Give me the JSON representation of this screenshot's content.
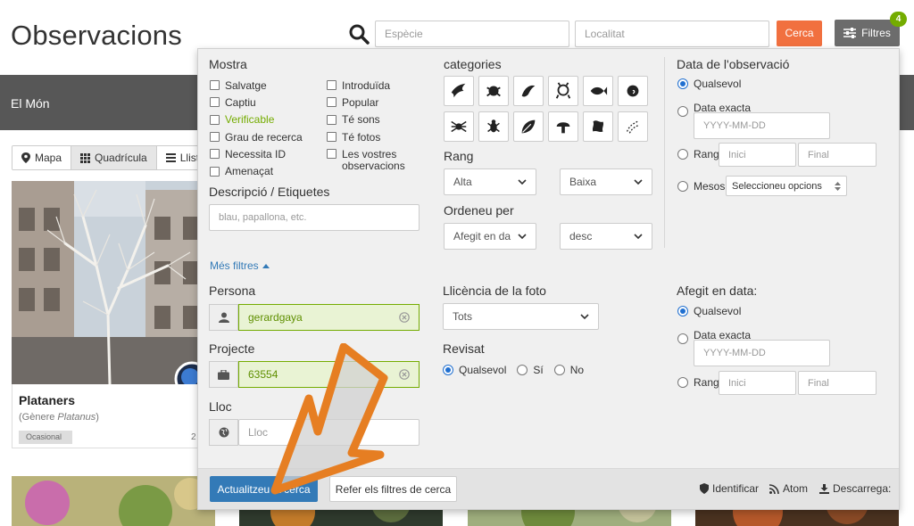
{
  "header": {
    "title": "Observacions",
    "species_placeholder": "Espècie",
    "location_placeholder": "Localitat",
    "search_label": "Cerca",
    "filters_label": "Filtres",
    "filters_count": "4"
  },
  "band": {
    "place": "El Món"
  },
  "view_tabs": [
    "Mapa",
    "Quadrícula",
    "Llista"
  ],
  "card": {
    "title": "Plataners",
    "subtitle_prefix": "(Gènere ",
    "subtitle_genus": "Platanus",
    "subtitle_suffix": ")",
    "tag": "Ocasional",
    "date": "2"
  },
  "filters": {
    "show_title": "Mostra",
    "show_left": [
      {
        "label": "Salvatge",
        "green": false
      },
      {
        "label": "Captiu",
        "green": false
      },
      {
        "label": "Verificable",
        "green": true
      },
      {
        "label": "Grau de recerca",
        "green": false
      },
      {
        "label": "Necessita ID",
        "green": false
      },
      {
        "label": "Amenaçat",
        "green": false
      }
    ],
    "show_right": [
      "Introduïda",
      "Popular",
      "Té sons",
      "Té fotos",
      "Les vostres"
    ],
    "show_right_cont": "observacions",
    "desc_title": "Descripció / Etiquetes",
    "desc_placeholder": "blau, papallona, etc.",
    "categories_title": "categories",
    "category_icons": [
      "bird-icon",
      "amphibian-icon",
      "reptile-icon",
      "mammal-icon",
      "fish-icon",
      "mollusk-icon",
      "arachnid-icon",
      "insect-icon",
      "plant-icon",
      "fungi-icon",
      "protozoa-icon",
      "unknown-icon"
    ],
    "rank_title": "Rang",
    "rank_high": "Alta",
    "rank_low": "Baixa",
    "order_title": "Ordeneu per",
    "order_by": "Afegit en da",
    "order_dir": "desc",
    "date_title": "Data de l'observació",
    "date_any": "Qualsevol",
    "date_exact": "Data exacta",
    "date_placeholder": "YYYY-MM-DD",
    "date_range": "Rang",
    "range_start": "Inici",
    "range_end": "Final",
    "months": "Mesos",
    "months_select": "Seleccioneu opcions",
    "more_filters": "Més filtres",
    "person_title": "Persona",
    "person_value": "gerardgaya",
    "project_title": "Projecte",
    "project_value": "63554",
    "place_title": "Lloc",
    "place_placeholder": "Lloc",
    "license_title": "Llicència de la foto",
    "license_value": "Tots",
    "reviewed_title": "Revisat",
    "reviewed_any": "Qualsevol",
    "reviewed_yes": "Sí",
    "reviewed_no": "No",
    "added_title": "Afegit en data:",
    "added_any": "Qualsevol",
    "added_exact": "Data exacta",
    "added_placeholder": "YYYY-MM-DD",
    "added_range": "Rang",
    "added_start": "Inici",
    "added_end": "Final"
  },
  "footer": {
    "update": "Actualitzeu la cerca",
    "reset": "Refer els filtres de cerca",
    "identify": "Identificar",
    "atom": "Atom",
    "download": "Descarrega:"
  },
  "colors": {
    "accent_orange": "#f1703f",
    "inat_green": "#74ac00",
    "primary_blue": "#337ab7",
    "arrow_orange": "#e67e22"
  }
}
